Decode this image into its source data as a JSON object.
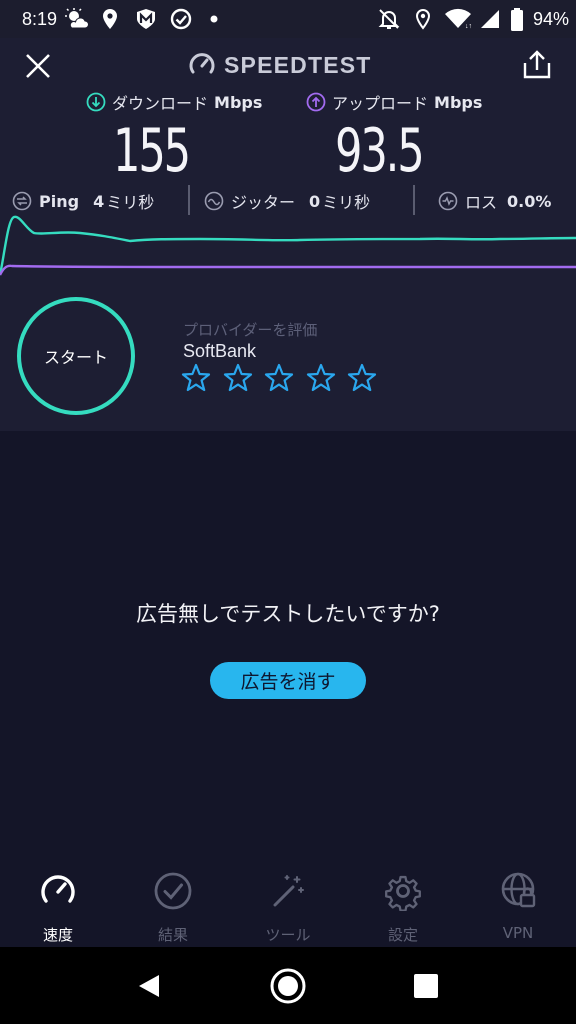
{
  "status_bar": {
    "time": "8:19",
    "battery": "94%"
  },
  "header": {
    "title": "SPEEDTEST"
  },
  "download": {
    "label": "ダウンロード",
    "unit": "Mbps",
    "value": "155"
  },
  "upload": {
    "label": "アップロード",
    "unit": "Mbps",
    "value": "93.5"
  },
  "stats": {
    "ping": {
      "label": "Ping",
      "value": "4",
      "unit": "ミリ秒"
    },
    "jitter": {
      "label": "ジッター",
      "value": "0",
      "unit": "ミリ秒"
    },
    "loss": {
      "label": "ロス",
      "value": "0.0%"
    }
  },
  "colors": {
    "download": "#35dcc0",
    "upload": "#a26bf0",
    "accent": "#28b6ee",
    "star": "#2aa7ee"
  },
  "start_button": {
    "label": "スタート"
  },
  "provider": {
    "caption": "プロバイダーを評価",
    "name": "SoftBank",
    "stars_total": 5,
    "stars_filled": 0
  },
  "ad": {
    "question": "広告無しでテストしたいですか?",
    "button": "広告を消す"
  },
  "nav": {
    "items": [
      {
        "label": "速度",
        "icon": "speed-gauge-icon",
        "active": true
      },
      {
        "label": "結果",
        "icon": "check-circle-icon",
        "active": false
      },
      {
        "label": "ツール",
        "icon": "magic-wand-icon",
        "active": false
      },
      {
        "label": "設定",
        "icon": "gear-icon",
        "active": false
      },
      {
        "label": "VPN",
        "icon": "vpn-globe-lock-icon",
        "active": false
      }
    ]
  }
}
